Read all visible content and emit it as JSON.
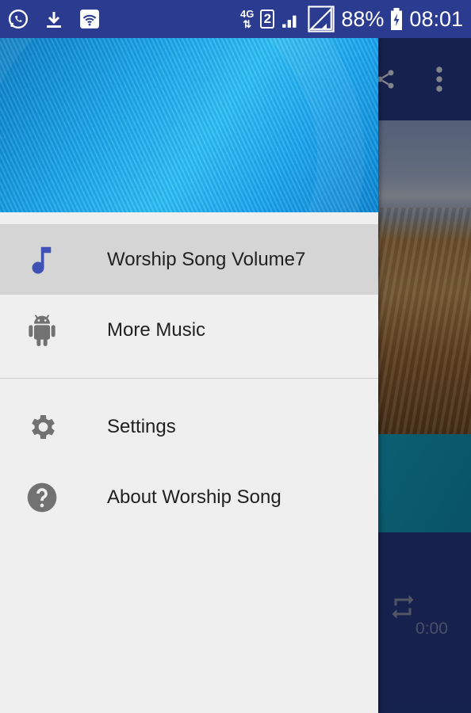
{
  "status_bar": {
    "network": "4G",
    "sim_slot": "2",
    "battery": "88%",
    "time": "08:01",
    "icons": [
      "whatsapp-icon",
      "download-icon",
      "wifi-icon",
      "signal-icon",
      "signal-icon-2",
      "battery-icon"
    ]
  },
  "drawer": {
    "items": [
      {
        "label": "Worship Song Volume7",
        "icon": "music-note-icon",
        "active": true
      },
      {
        "label": "More Music",
        "icon": "android-icon",
        "active": false
      }
    ],
    "secondary_items": [
      {
        "label": "Settings",
        "icon": "gear-icon"
      },
      {
        "label": "About Worship Song",
        "icon": "help-icon"
      }
    ]
  },
  "background_app": {
    "player_time": "0:00"
  },
  "colors": {
    "primary": "#2b3b8f",
    "accent_icon": "#3f51b5",
    "drawer_bg": "#efefef",
    "active_item_bg": "#d5d5d5"
  }
}
